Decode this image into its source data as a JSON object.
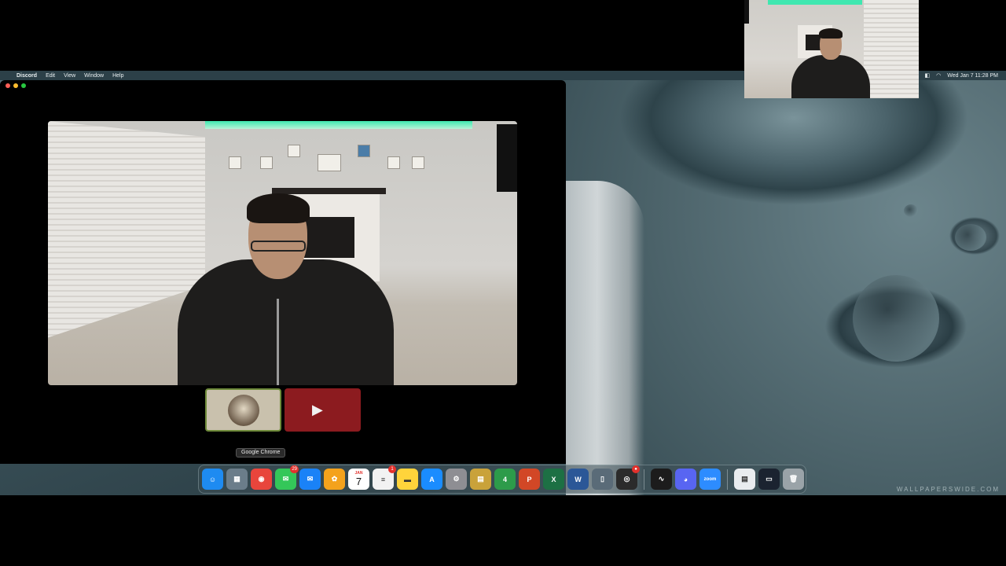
{
  "menubar": {
    "apple": "",
    "app_name": "Discord",
    "items": [
      "Edit",
      "View",
      "Window",
      "Help"
    ],
    "clock": "Wed Jan 7  11:28 PM"
  },
  "discord": {
    "traffic_colors": [
      "#ff5f57",
      "#febc2e",
      "#28c840"
    ],
    "camera_off_tile_color": "#8c1b1f"
  },
  "tooltip": {
    "label": "Google Chrome"
  },
  "dock": {
    "apps": [
      {
        "name": "finder",
        "icon": "finder-icon",
        "glyph": "☺",
        "color": "#1e8bf1"
      },
      {
        "name": "launchpad",
        "icon": "launchpad-icon",
        "glyph": "▦",
        "color": "#6b7d8a"
      },
      {
        "name": "google-chrome",
        "icon": "chrome-icon",
        "glyph": "◉",
        "color": "#e8453c"
      },
      {
        "name": "messages",
        "icon": "messages-icon",
        "glyph": "✉",
        "color": "#34c759",
        "badge": "29"
      },
      {
        "name": "mail",
        "icon": "mail-icon",
        "glyph": "✉",
        "color": "#1a82f7"
      },
      {
        "name": "photos",
        "icon": "photos-icon",
        "glyph": "✿",
        "color": "#f4a21c"
      },
      {
        "name": "calendar",
        "icon": "calendar-icon",
        "month": "JAN",
        "day": "7"
      },
      {
        "name": "reminders",
        "icon": "reminders-icon",
        "glyph": "≡",
        "color": "#f2f2f2",
        "badge": "1"
      },
      {
        "name": "notes",
        "icon": "notes-icon",
        "glyph": "▬",
        "color": "#ffd43b"
      },
      {
        "name": "app-store",
        "icon": "app-store-icon",
        "glyph": "A",
        "color": "#1a8cff"
      },
      {
        "name": "system-settings",
        "icon": "settings-icon",
        "glyph": "⚙",
        "color": "#8e8e93"
      },
      {
        "name": "archive-utility",
        "icon": "archive-icon",
        "glyph": "▤",
        "color": "#c9a23a"
      },
      {
        "name": "metatrader",
        "icon": "metatrader-icon",
        "glyph": "4",
        "color": "#2d9b4a"
      },
      {
        "name": "powerpoint",
        "icon": "powerpoint-icon",
        "glyph": "P",
        "color": "#d24726"
      },
      {
        "name": "excel",
        "icon": "excel-icon",
        "glyph": "X",
        "color": "#1d7044"
      },
      {
        "name": "word",
        "icon": "word-icon",
        "glyph": "W",
        "color": "#2b5797"
      },
      {
        "name": "iphone-mirroring",
        "icon": "iphone-icon",
        "glyph": "▯",
        "color": "#5a6b78"
      },
      {
        "name": "obs",
        "icon": "obs-icon",
        "glyph": "◎",
        "color": "#2b2b2b",
        "badge": "●"
      }
    ],
    "pinned": [
      {
        "name": "activity-monitor",
        "icon": "activity-monitor-icon",
        "glyph": "∿",
        "color": "#1c1c1c"
      },
      {
        "name": "discord",
        "icon": "discord-icon",
        "glyph": "◕",
        "color": "#5865f2"
      },
      {
        "name": "zoom",
        "icon": "zoom-icon",
        "label": "zoom",
        "color": "#2d8cff"
      }
    ],
    "stacks": [
      {
        "name": "documents",
        "icon": "document-icon",
        "glyph": "▤",
        "color": "#e9ecef"
      },
      {
        "name": "screenshot",
        "icon": "screenshot-icon",
        "glyph": "▭",
        "color": "#1b2330"
      },
      {
        "name": "trash",
        "icon": "trash-icon",
        "glyph": "🗑",
        "color": "#9aa3a8"
      }
    ]
  },
  "wallpaper": {
    "watermark": "WALLPAPERSWIDE.COM"
  }
}
